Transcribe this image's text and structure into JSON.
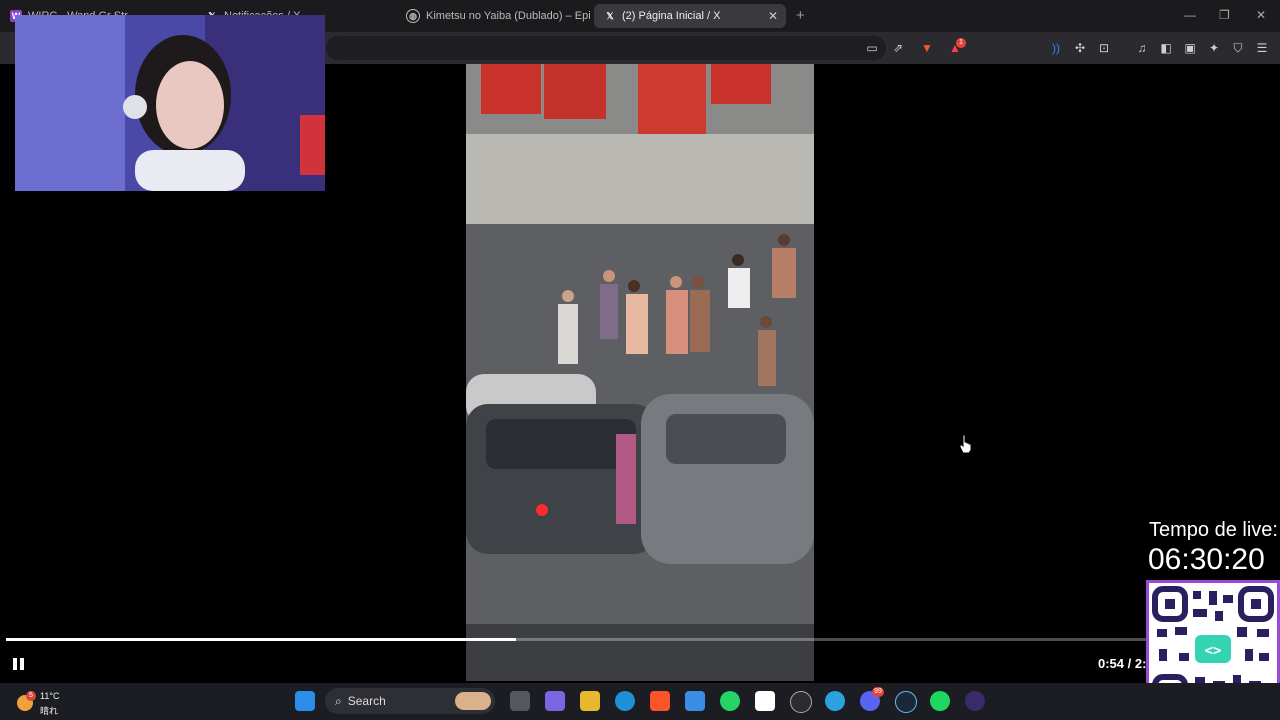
{
  "browser": {
    "tabs": [
      {
        "title": "WIRC - Wand Gr Str",
        "favicon": "streaming-site-icon",
        "active": false
      },
      {
        "title": "Notificações / X",
        "favicon": "x-logo-icon",
        "active": false
      },
      {
        "title": "Kimetsu no Yaiba (Dublado) – Epi",
        "favicon": "globe-icon",
        "active": false
      },
      {
        "title": "(2) Página Inicial / X",
        "favicon": "x-logo-icon",
        "active": true
      }
    ],
    "new_tab_label": "+",
    "brave_badge": "1"
  },
  "video": {
    "timecode": "0:54 / 2:",
    "progress_fraction": 0.447
  },
  "overlay": {
    "live_label": "Tempo de live:",
    "live_time": "06:30:20"
  },
  "taskbar": {
    "weather_temp": "11°C",
    "weather_desc": "晴れ",
    "weather_badge": "5",
    "search_label": "Search",
    "discord_badge": "99"
  }
}
